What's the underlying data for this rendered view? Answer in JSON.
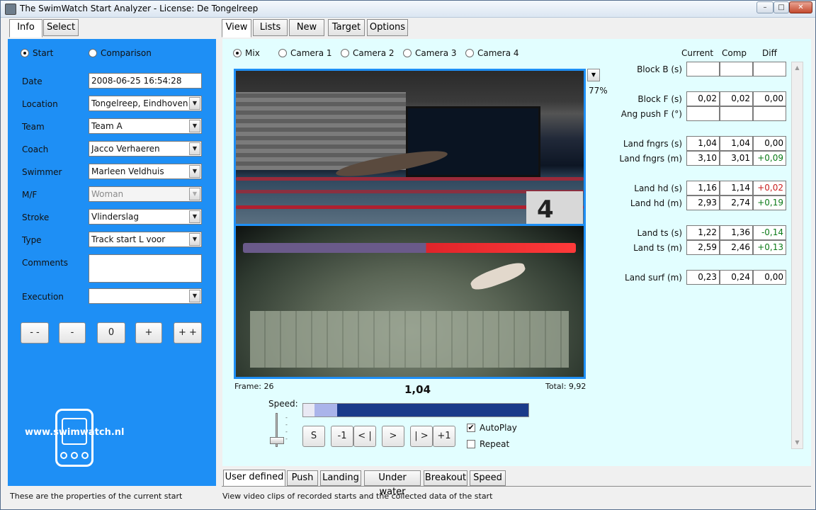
{
  "window": {
    "title": "The SwimWatch Start Analyzer - License: De Tongelreep",
    "controls": {
      "minimize": "–",
      "maximize": "□",
      "close": "✕"
    }
  },
  "left_tabs": [
    "Info",
    "Select"
  ],
  "main_tabs": [
    "View",
    "Lists",
    "New",
    "Target",
    "Options"
  ],
  "info": {
    "radio_start": "Start",
    "radio_comparison": "Comparison",
    "fields": [
      {
        "label": "Date",
        "value": "2008-06-25 16:54:28"
      },
      {
        "label": "Location",
        "value": "Tongelreep, Eindhoven"
      },
      {
        "label": "Team",
        "value": "Team A"
      },
      {
        "label": "Coach",
        "value": "Jacco Verhaeren"
      },
      {
        "label": "Swimmer",
        "value": "Marleen Veldhuis"
      },
      {
        "label": "M/F",
        "value": "Woman"
      },
      {
        "label": "Stroke",
        "value": "Vlinderslag"
      },
      {
        "label": "Type",
        "value": "Track start L voor"
      },
      {
        "label": "Comments",
        "value": ""
      },
      {
        "label": "Execution",
        "value": ""
      }
    ],
    "rating_buttons": [
      "- -",
      "-",
      "0",
      "+",
      "+ +"
    ],
    "logo_text": "www.swimwatch.nl"
  },
  "view": {
    "radios": [
      "Mix",
      "Camera 1",
      "Camera 2",
      "Camera 3",
      "Camera 4"
    ],
    "zoom": "77%",
    "frame_text": "Frame: 26",
    "time_big": "1,04",
    "total_text": "Total: 9,92",
    "speed_label": "Speed:",
    "controls": [
      "S",
      "-1",
      "< |",
      ">",
      "| >",
      "+1"
    ],
    "autoplay": "AutoPlay",
    "repeat": "Repeat"
  },
  "measurements": {
    "headers": [
      "Current",
      "Comp",
      "Diff"
    ],
    "rows": [
      {
        "label": "Block B (s)",
        "current": "",
        "comp": "",
        "diff": "",
        "sign": ""
      },
      {
        "label": "Block F (s)",
        "current": "0,02",
        "comp": "0,02",
        "diff": "0,00",
        "sign": ""
      },
      {
        "label": "Ang push F (°)",
        "current": "",
        "comp": "",
        "diff": "",
        "sign": ""
      },
      {
        "label": "Land fngrs (s)",
        "current": "1,04",
        "comp": "1,04",
        "diff": "0,00",
        "sign": ""
      },
      {
        "label": "Land fngrs (m)",
        "current": "3,10",
        "comp": "3,01",
        "diff": "+0,09",
        "sign": "pos"
      },
      {
        "label": "Land hd (s)",
        "current": "1,16",
        "comp": "1,14",
        "diff": "+0,02",
        "sign": "neg"
      },
      {
        "label": "Land hd (m)",
        "current": "2,93",
        "comp": "2,74",
        "diff": "+0,19",
        "sign": "pos"
      },
      {
        "label": "Land ts (s)",
        "current": "1,22",
        "comp": "1,36",
        "diff": "-0,14",
        "sign": "pos"
      },
      {
        "label": "Land ts (m)",
        "current": "2,59",
        "comp": "2,46",
        "diff": "+0,13",
        "sign": "pos"
      },
      {
        "label": "Land surf (m)",
        "current": "0,23",
        "comp": "0,24",
        "diff": "0,00",
        "sign": ""
      }
    ]
  },
  "bottom_tabs": [
    "User defined",
    "Push",
    "Landing",
    "Under water",
    "Breakout",
    "Speed"
  ],
  "status": {
    "left": "These are the properties of the current start",
    "right": "View video clips of recorded starts and the collected data of the start"
  },
  "colors": {
    "panel_blue": "#1e8ff5",
    "view_bg": "#e2feff",
    "timeline_dark": "#1a3a8a",
    "pos": "#0b7a17",
    "neg": "#c81e1e"
  }
}
